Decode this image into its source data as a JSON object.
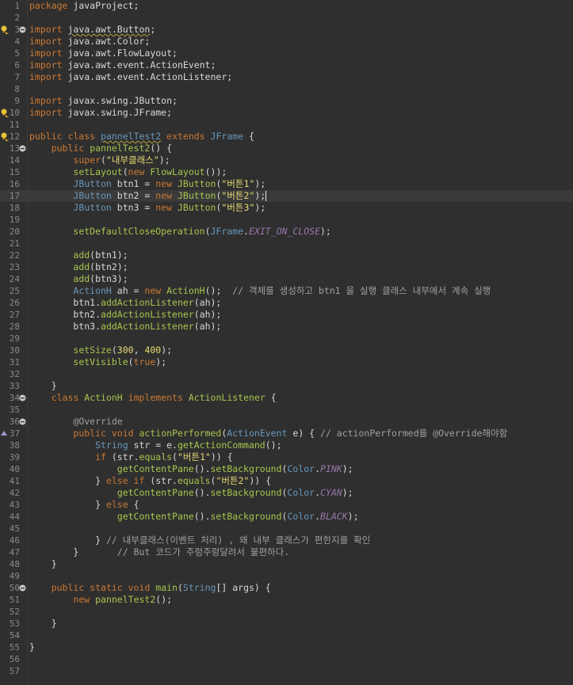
{
  "editor": {
    "language": "java",
    "current_line": 17,
    "colors": {
      "background": "#2f2f2f",
      "keyword": "#cc7832",
      "type": "#6897bb",
      "string": "#e6db74",
      "comment": "#a0a0a0",
      "method": "#a6c64e",
      "constant": "#9876aa"
    },
    "lines": [
      [
        {
          "t": "kw",
          "v": "package"
        },
        {
          "t": "plain",
          "v": " javaProject;"
        }
      ],
      [],
      [
        {
          "t": "kw",
          "v": "import"
        },
        {
          "t": "plain",
          "v": " "
        },
        {
          "t": "warnplain",
          "v": "java.awt.Button"
        },
        {
          "t": "plain",
          "v": ";"
        }
      ],
      [
        {
          "t": "kw",
          "v": "import"
        },
        {
          "t": "plain",
          "v": " java.awt.Color;"
        }
      ],
      [
        {
          "t": "kw",
          "v": "import"
        },
        {
          "t": "plain",
          "v": " java.awt.FlowLayout;"
        }
      ],
      [
        {
          "t": "kw",
          "v": "import"
        },
        {
          "t": "plain",
          "v": " java.awt.event.ActionEvent;"
        }
      ],
      [
        {
          "t": "kw",
          "v": "import"
        },
        {
          "t": "plain",
          "v": " java.awt.event.ActionListener;"
        }
      ],
      [],
      [
        {
          "t": "kw",
          "v": "import"
        },
        {
          "t": "plain",
          "v": " javax.swing.JButton;"
        }
      ],
      [
        {
          "t": "kw",
          "v": "import"
        },
        {
          "t": "plain",
          "v": " javax.swing.JFrame;"
        }
      ],
      [],
      [
        {
          "t": "kw",
          "v": "public class"
        },
        {
          "t": "plain",
          "v": " "
        },
        {
          "t": "warncls",
          "v": "pannelTest2"
        },
        {
          "t": "plain",
          "v": " "
        },
        {
          "t": "kw",
          "v": "extends"
        },
        {
          "t": "plain",
          "v": " "
        },
        {
          "t": "type",
          "v": "JFrame"
        },
        {
          "t": "plain",
          "v": " {"
        }
      ],
      [
        {
          "t": "plain",
          "v": "    "
        },
        {
          "t": "kw",
          "v": "public"
        },
        {
          "t": "plain",
          "v": " "
        },
        {
          "t": "meth",
          "v": "pannelTest2"
        },
        {
          "t": "plain",
          "v": "() {"
        }
      ],
      [
        {
          "t": "plain",
          "v": "        "
        },
        {
          "t": "kw",
          "v": "super"
        },
        {
          "t": "plain",
          "v": "("
        },
        {
          "t": "str",
          "v": "\"내부클래스\""
        },
        {
          "t": "plain",
          "v": ");"
        }
      ],
      [
        {
          "t": "plain",
          "v": "        "
        },
        {
          "t": "meth",
          "v": "setLayout"
        },
        {
          "t": "plain",
          "v": "("
        },
        {
          "t": "kw",
          "v": "new"
        },
        {
          "t": "plain",
          "v": " "
        },
        {
          "t": "meth",
          "v": "FlowLayout"
        },
        {
          "t": "plain",
          "v": "());"
        }
      ],
      [
        {
          "t": "plain",
          "v": "        "
        },
        {
          "t": "type",
          "v": "JButton"
        },
        {
          "t": "plain",
          "v": " btn1 = "
        },
        {
          "t": "kw",
          "v": "new"
        },
        {
          "t": "plain",
          "v": " "
        },
        {
          "t": "meth",
          "v": "JButton"
        },
        {
          "t": "plain",
          "v": "("
        },
        {
          "t": "str",
          "v": "\"버튼1\""
        },
        {
          "t": "plain",
          "v": ");"
        }
      ],
      [
        {
          "t": "plain",
          "v": "        "
        },
        {
          "t": "type",
          "v": "JButton"
        },
        {
          "t": "plain",
          "v": " btn2 = "
        },
        {
          "t": "kw",
          "v": "new"
        },
        {
          "t": "plain",
          "v": " "
        },
        {
          "t": "meth",
          "v": "JButton"
        },
        {
          "t": "plain",
          "v": "("
        },
        {
          "t": "str",
          "v": "\"버튼2\""
        },
        {
          "t": "plain",
          "v": ");"
        }
      ],
      [
        {
          "t": "plain",
          "v": "        "
        },
        {
          "t": "type",
          "v": "JButton"
        },
        {
          "t": "plain",
          "v": " btn3 = "
        },
        {
          "t": "kw",
          "v": "new"
        },
        {
          "t": "plain",
          "v": " "
        },
        {
          "t": "meth",
          "v": "JButton"
        },
        {
          "t": "plain",
          "v": "("
        },
        {
          "t": "str",
          "v": "\"버튼3\""
        },
        {
          "t": "plain",
          "v": ");"
        }
      ],
      [],
      [
        {
          "t": "plain",
          "v": "        "
        },
        {
          "t": "meth",
          "v": "setDefaultCloseOperation"
        },
        {
          "t": "plain",
          "v": "("
        },
        {
          "t": "type",
          "v": "JFrame"
        },
        {
          "t": "plain",
          "v": "."
        },
        {
          "t": "const",
          "v": "EXIT_ON_CLOSE"
        },
        {
          "t": "plain",
          "v": ");"
        }
      ],
      [],
      [
        {
          "t": "plain",
          "v": "        "
        },
        {
          "t": "meth",
          "v": "add"
        },
        {
          "t": "plain",
          "v": "(btn1);"
        }
      ],
      [
        {
          "t": "plain",
          "v": "        "
        },
        {
          "t": "meth",
          "v": "add"
        },
        {
          "t": "plain",
          "v": "(btn2);"
        }
      ],
      [
        {
          "t": "plain",
          "v": "        "
        },
        {
          "t": "meth",
          "v": "add"
        },
        {
          "t": "plain",
          "v": "(btn3);"
        }
      ],
      [
        {
          "t": "plain",
          "v": "        "
        },
        {
          "t": "type",
          "v": "ActionH"
        },
        {
          "t": "plain",
          "v": " ah = "
        },
        {
          "t": "kw",
          "v": "new"
        },
        {
          "t": "plain",
          "v": " "
        },
        {
          "t": "meth",
          "v": "ActionH"
        },
        {
          "t": "plain",
          "v": "();  "
        },
        {
          "t": "cm",
          "v": "// 객체를 생성하고 btn1 을 실행 클래스 내부에서 계속 실행"
        }
      ],
      [
        {
          "t": "plain",
          "v": "        btn1."
        },
        {
          "t": "meth",
          "v": "addActionListener"
        },
        {
          "t": "plain",
          "v": "(ah);"
        }
      ],
      [
        {
          "t": "plain",
          "v": "        btn2."
        },
        {
          "t": "meth",
          "v": "addActionListener"
        },
        {
          "t": "plain",
          "v": "(ah);"
        }
      ],
      [
        {
          "t": "plain",
          "v": "        btn3."
        },
        {
          "t": "meth",
          "v": "addActionListener"
        },
        {
          "t": "plain",
          "v": "(ah);"
        }
      ],
      [],
      [
        {
          "t": "plain",
          "v": "        "
        },
        {
          "t": "meth",
          "v": "setSize"
        },
        {
          "t": "plain",
          "v": "("
        },
        {
          "t": "num",
          "v": "300"
        },
        {
          "t": "plain",
          "v": ", "
        },
        {
          "t": "num",
          "v": "400"
        },
        {
          "t": "plain",
          "v": ");"
        }
      ],
      [
        {
          "t": "plain",
          "v": "        "
        },
        {
          "t": "meth",
          "v": "setVisible"
        },
        {
          "t": "plain",
          "v": "("
        },
        {
          "t": "kw",
          "v": "true"
        },
        {
          "t": "plain",
          "v": ");"
        }
      ],
      [],
      [
        {
          "t": "plain",
          "v": "    }"
        }
      ],
      [
        {
          "t": "plain",
          "v": "    "
        },
        {
          "t": "kw",
          "v": "class"
        },
        {
          "t": "plain",
          "v": " "
        },
        {
          "t": "meth",
          "v": "ActionH"
        },
        {
          "t": "plain",
          "v": " "
        },
        {
          "t": "kw",
          "v": "implements"
        },
        {
          "t": "plain",
          "v": " "
        },
        {
          "t": "meth",
          "v": "ActionListener"
        },
        {
          "t": "plain",
          "v": " {"
        }
      ],
      [],
      [
        {
          "t": "plain",
          "v": "        "
        },
        {
          "t": "ann",
          "v": "@Override"
        }
      ],
      [
        {
          "t": "plain",
          "v": "        "
        },
        {
          "t": "kw",
          "v": "public void"
        },
        {
          "t": "plain",
          "v": " "
        },
        {
          "t": "meth",
          "v": "actionPerformed"
        },
        {
          "t": "plain",
          "v": "("
        },
        {
          "t": "type",
          "v": "ActionEvent"
        },
        {
          "t": "plain",
          "v": " e) { "
        },
        {
          "t": "cm",
          "v": "// actionPerformed를 @Override해야함"
        }
      ],
      [
        {
          "t": "plain",
          "v": "            "
        },
        {
          "t": "type",
          "v": "String"
        },
        {
          "t": "plain",
          "v": " str = e."
        },
        {
          "t": "meth",
          "v": "getActionCommand"
        },
        {
          "t": "plain",
          "v": "();"
        }
      ],
      [
        {
          "t": "plain",
          "v": "            "
        },
        {
          "t": "kw",
          "v": "if"
        },
        {
          "t": "plain",
          "v": " (str."
        },
        {
          "t": "meth",
          "v": "equals"
        },
        {
          "t": "plain",
          "v": "("
        },
        {
          "t": "str",
          "v": "\"버튼1\""
        },
        {
          "t": "plain",
          "v": ")) {"
        }
      ],
      [
        {
          "t": "plain",
          "v": "                "
        },
        {
          "t": "meth",
          "v": "getContentPane"
        },
        {
          "t": "plain",
          "v": "()."
        },
        {
          "t": "meth",
          "v": "setBackground"
        },
        {
          "t": "plain",
          "v": "("
        },
        {
          "t": "type",
          "v": "Color"
        },
        {
          "t": "plain",
          "v": "."
        },
        {
          "t": "const",
          "v": "PINK"
        },
        {
          "t": "plain",
          "v": ");"
        }
      ],
      [
        {
          "t": "plain",
          "v": "            } "
        },
        {
          "t": "kw",
          "v": "else if"
        },
        {
          "t": "plain",
          "v": " (str."
        },
        {
          "t": "meth",
          "v": "equals"
        },
        {
          "t": "plain",
          "v": "("
        },
        {
          "t": "str",
          "v": "\"버튼2\""
        },
        {
          "t": "plain",
          "v": ")) {"
        }
      ],
      [
        {
          "t": "plain",
          "v": "                "
        },
        {
          "t": "meth",
          "v": "getContentPane"
        },
        {
          "t": "plain",
          "v": "()."
        },
        {
          "t": "meth",
          "v": "setBackground"
        },
        {
          "t": "plain",
          "v": "("
        },
        {
          "t": "type",
          "v": "Color"
        },
        {
          "t": "plain",
          "v": "."
        },
        {
          "t": "const",
          "v": "CYAN"
        },
        {
          "t": "plain",
          "v": ");"
        }
      ],
      [
        {
          "t": "plain",
          "v": "            } "
        },
        {
          "t": "kw",
          "v": "else"
        },
        {
          "t": "plain",
          "v": " {"
        }
      ],
      [
        {
          "t": "plain",
          "v": "                "
        },
        {
          "t": "meth",
          "v": "getContentPane"
        },
        {
          "t": "plain",
          "v": "()."
        },
        {
          "t": "meth",
          "v": "setBackground"
        },
        {
          "t": "plain",
          "v": "("
        },
        {
          "t": "type",
          "v": "Color"
        },
        {
          "t": "plain",
          "v": "."
        },
        {
          "t": "const",
          "v": "BLACK"
        },
        {
          "t": "plain",
          "v": ");"
        }
      ],
      [],
      [
        {
          "t": "plain",
          "v": "            } "
        },
        {
          "t": "cm",
          "v": "// 내부클래스(이벤트 처리) , 왜 내부 클래스가 편한지를 확인"
        }
      ],
      [
        {
          "t": "plain",
          "v": "        }       "
        },
        {
          "t": "cm",
          "v": "// But 코드가 주렁주렁달려서 불편하다."
        }
      ],
      [
        {
          "t": "plain",
          "v": "    }"
        }
      ],
      [],
      [
        {
          "t": "plain",
          "v": "    "
        },
        {
          "t": "kw",
          "v": "public static void"
        },
        {
          "t": "plain",
          "v": " "
        },
        {
          "t": "meth",
          "v": "main"
        },
        {
          "t": "plain",
          "v": "("
        },
        {
          "t": "type",
          "v": "String"
        },
        {
          "t": "plain",
          "v": "[] args) {"
        }
      ],
      [
        {
          "t": "plain",
          "v": "        "
        },
        {
          "t": "kw",
          "v": "new"
        },
        {
          "t": "plain",
          "v": " "
        },
        {
          "t": "meth",
          "v": "pannelTest2"
        },
        {
          "t": "plain",
          "v": "();"
        }
      ],
      [],
      [
        {
          "t": "plain",
          "v": "    }"
        }
      ],
      [],
      [
        {
          "t": "plain",
          "v": "}"
        }
      ],
      [],
      []
    ],
    "fold_lines": [
      3,
      13,
      34,
      36,
      50
    ],
    "warning_markers": [
      3,
      10,
      12
    ],
    "override_markers": [
      37
    ]
  }
}
